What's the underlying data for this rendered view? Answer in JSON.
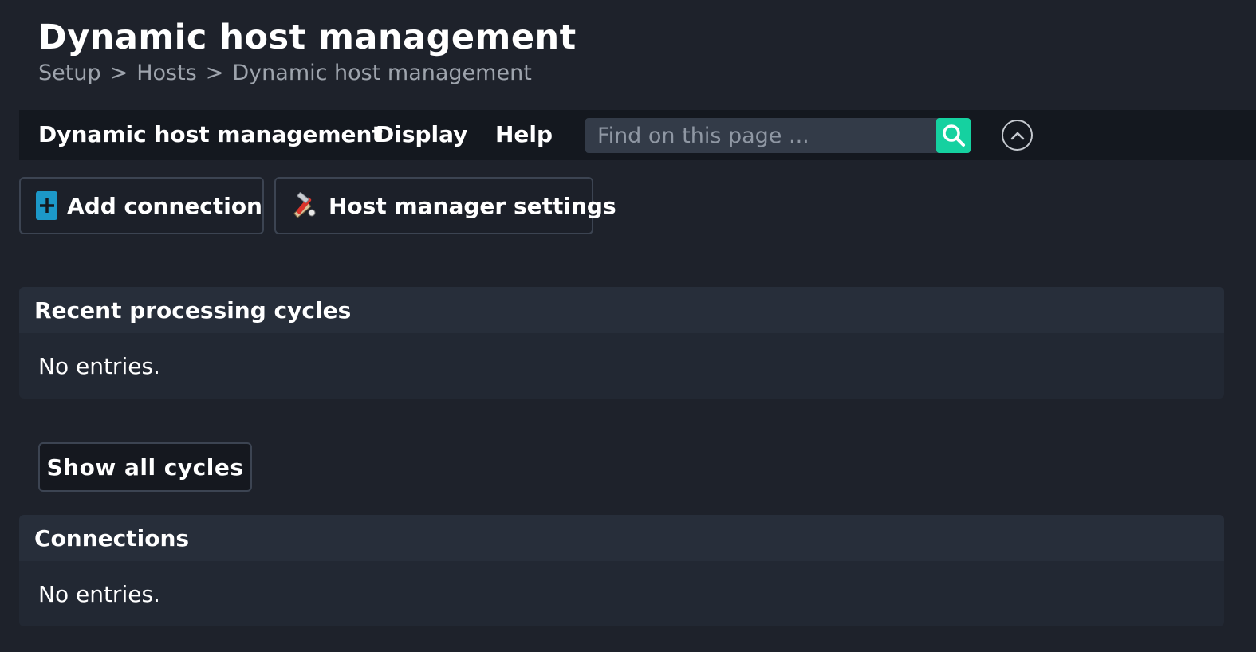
{
  "page": {
    "title": "Dynamic host management",
    "breadcrumb": [
      "Setup",
      "Hosts",
      "Dynamic host management"
    ],
    "breadcrumb_separator": ">"
  },
  "menubar": {
    "items": [
      "Dynamic host management",
      "Display",
      "Help"
    ],
    "search_placeholder": "Find on this page ...",
    "search_icon": "search-icon",
    "collapse_icon": "chevron-up-circle-icon"
  },
  "actions": {
    "add_connection": "Add connection",
    "host_manager_settings": "Host manager settings"
  },
  "sections": {
    "recent_cycles": {
      "title": "Recent processing cycles",
      "empty_text": "No entries."
    },
    "show_all_cycles": "Show all cycles",
    "connections": {
      "title": "Connections",
      "empty_text": "No entries."
    }
  },
  "colors": {
    "background": "#1e222b",
    "menubar": "#14181f",
    "search_accent": "#15d1a0",
    "add_icon": "#1c98c8",
    "muted_text": "#9ea4ad"
  }
}
